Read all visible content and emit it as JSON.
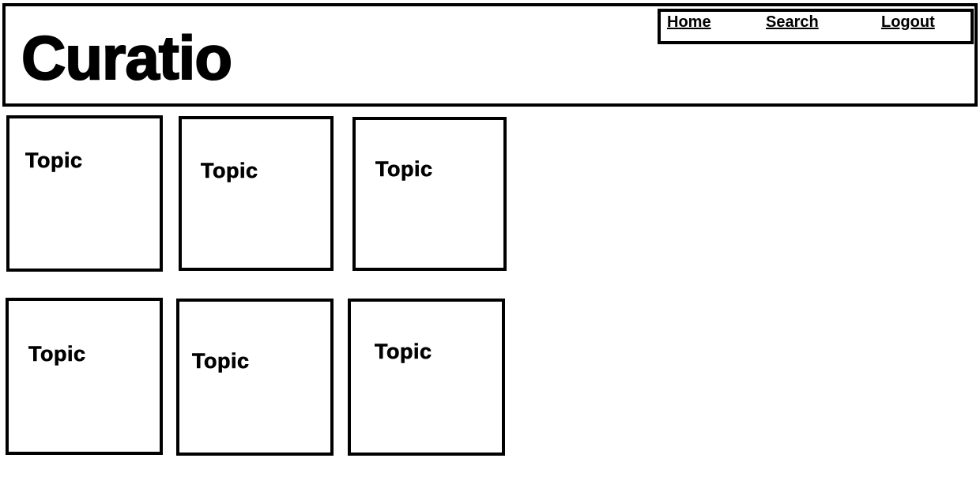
{
  "header": {
    "title": "Curatio"
  },
  "nav": {
    "items": [
      "Home",
      "Search",
      "Logout"
    ]
  },
  "topics": [
    "Topic",
    "Topic",
    "Topic",
    "Topic",
    "Topic",
    "Topic"
  ]
}
